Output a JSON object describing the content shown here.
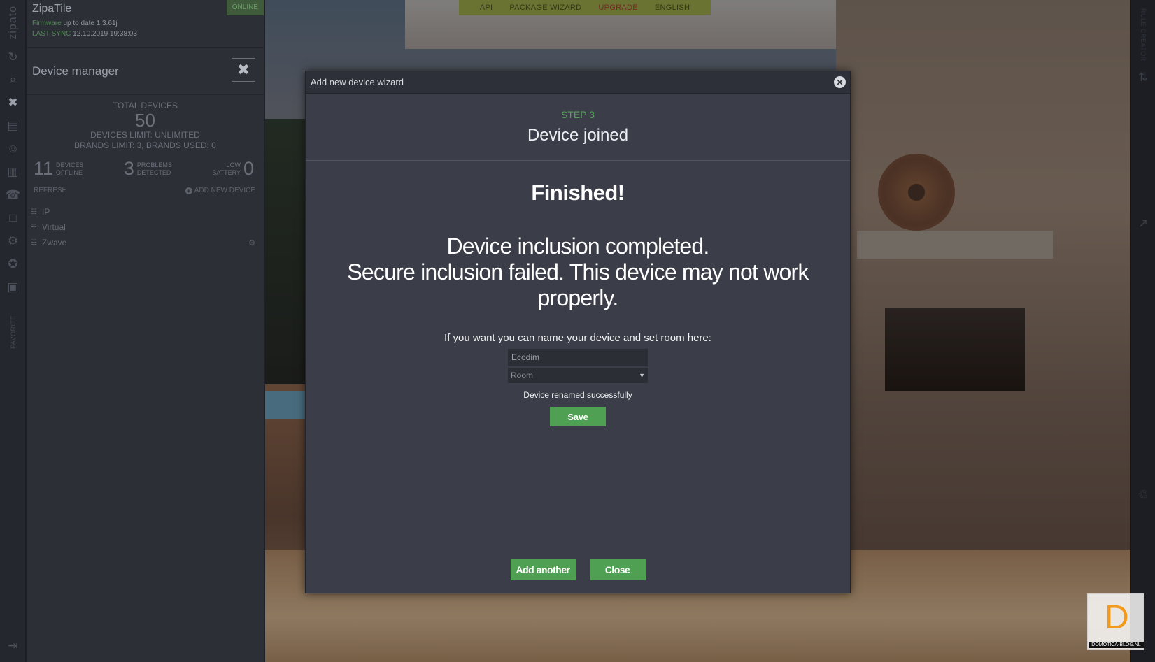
{
  "app": {
    "title": "ZipaTile",
    "status": "ONLINE",
    "firmware_label": "Firmware",
    "firmware_value": "up to date 1.3.61j",
    "last_sync_label": "LAST SYNC",
    "last_sync_value": "12.10.2019 19:38:03",
    "brand": "zipato"
  },
  "sidebar": {
    "favorite_label": "FAVORITE",
    "icons": [
      "sync-icon",
      "search-icon",
      "device-manager-icon",
      "scenes-icon",
      "users-icon",
      "rules-icon",
      "support-icon",
      "folder-icon",
      "settings-icon",
      "awards-icon",
      "notes-icon",
      "logout-icon"
    ]
  },
  "device_manager": {
    "title": "Device manager",
    "total_devices_label": "TOTAL DEVICES",
    "total_devices": "50",
    "devices_limit": "DEVICES LIMIT: UNLIMITED",
    "brands_limit": "BRANDS LIMIT: 3, BRANDS USED: 0",
    "offline_count": "11",
    "offline_label_1": "DEVICES",
    "offline_label_2": "OFFLINE",
    "problems_count": "3",
    "problems_label_1": "PROBLEMS",
    "problems_label_2": "DETECTED",
    "battery_label_1": "LOW",
    "battery_label_2": "BATTERY",
    "battery_count": "0",
    "refresh": "REFRESH",
    "add_new_device": "ADD NEW DEVICE",
    "networks": [
      "IP",
      "Virtual",
      "Zwave"
    ]
  },
  "top_menu": {
    "items": [
      "API",
      "PACKAGE WIZARD",
      "UPGRADE",
      "ENGLISH"
    ],
    "accent": "#b4373b"
  },
  "right_rail": {
    "label": "RULE CREATOR"
  },
  "wizard": {
    "title": "Add new device wizard",
    "step": "STEP 3",
    "subtitle": "Device joined",
    "finished": "Finished!",
    "message_line1": "Device inclusion completed.",
    "message_line2": "Secure inclusion failed. This device may not work properly.",
    "hint": "If you want you can name your device and set room here:",
    "name_value": "Ecodim",
    "room_placeholder": "Room",
    "renamed_msg": "Device renamed successfully",
    "save": "Save",
    "add_another": "Add another",
    "close": "Close",
    "accent": "#4fa053"
  },
  "watermark": {
    "letter": "D",
    "text": "DOMOTICA-BLOG.NL"
  }
}
